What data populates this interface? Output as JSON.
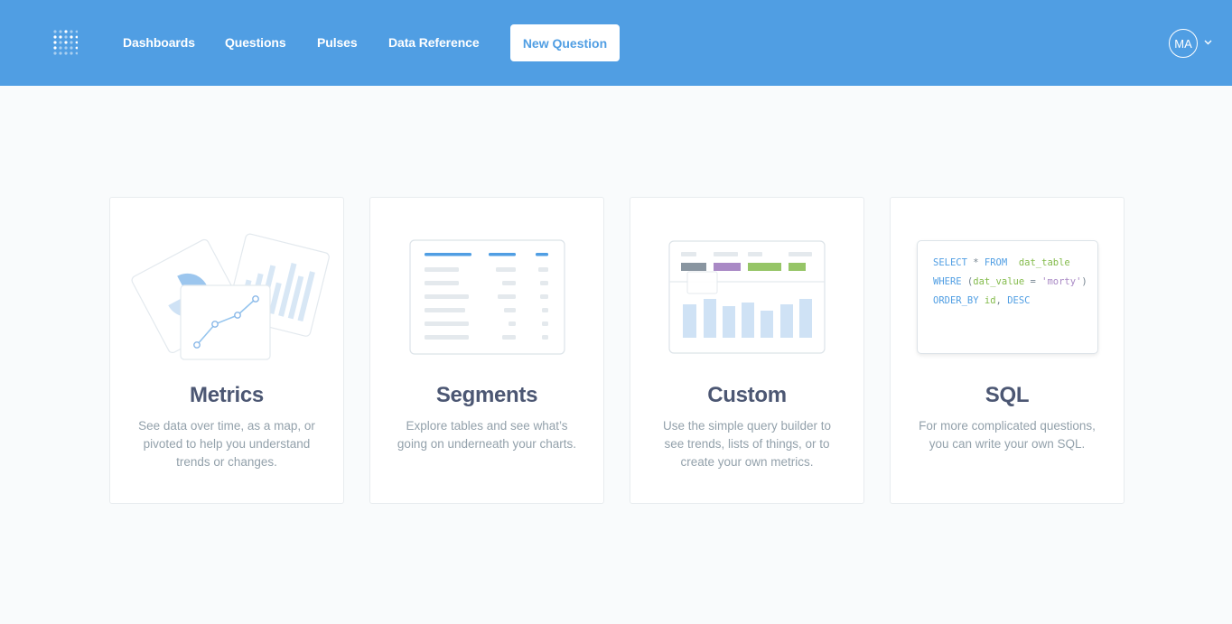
{
  "topbar": {
    "logo_icon": "metabase-logo-icon",
    "nav": [
      "Dashboards",
      "Questions",
      "Pulses",
      "Data Reference"
    ],
    "new_question_label": "New Question",
    "avatar_initials": "MA",
    "avatar_caret_icon": "chevron-down-icon",
    "background_color": "#509ee3"
  },
  "cards": [
    {
      "title": "Metrics",
      "description": "See data over time, as a map, or pivoted to help you understand trends or changes."
    },
    {
      "title": "Segments",
      "description": "Explore tables and see what’s going on underneath your charts."
    },
    {
      "title": "Custom",
      "description": "Use the simple query builder to see trends, lists of things, or to create your own metrics."
    },
    {
      "title": "SQL",
      "description": "For more complicated questions, you can write your own SQL."
    }
  ],
  "sql_preview": {
    "line1": {
      "kw1": "SELECT",
      "star": " * ",
      "kw2": "FROM",
      "table": "  dat_table"
    },
    "line2": {
      "kw": "WHERE",
      "open": " (",
      "col": "dat_value",
      "op": " = ",
      "val": "'morty'",
      "close": ")"
    },
    "line3": {
      "kw": "ORDER_BY",
      "col": " id",
      "comma": ", ",
      "dir": "DESC"
    }
  }
}
